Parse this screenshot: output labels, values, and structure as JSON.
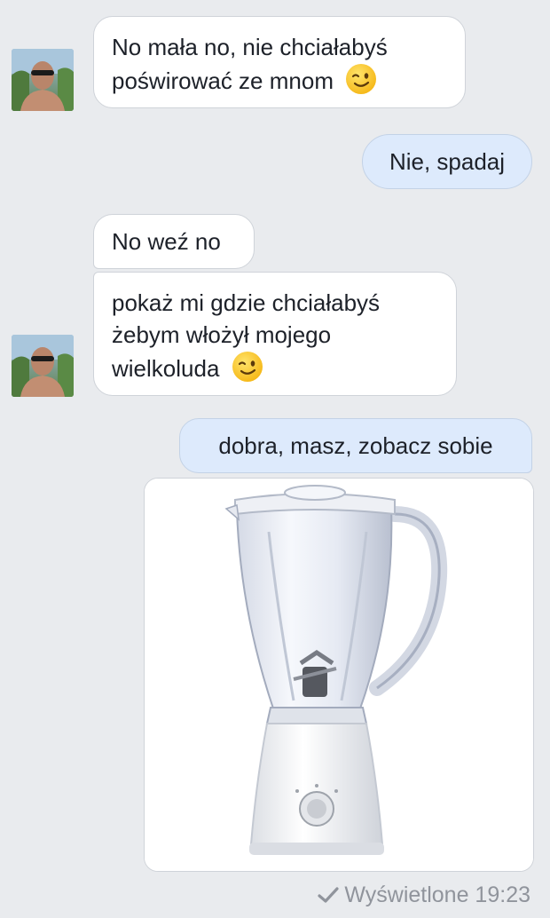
{
  "messages": [
    {
      "direction": "incoming",
      "text": "No mała no, nie chciałabyś poświrować ze mnom",
      "emoji": "winking-face"
    },
    {
      "direction": "outgoing",
      "text": "Nie, spadaj"
    },
    {
      "direction": "incoming",
      "text": "No weź no"
    },
    {
      "direction": "incoming",
      "text": "pokaż mi gdzie chciałabyś żebym włożył mojego wielkoluda",
      "emoji": "winking-face"
    },
    {
      "direction": "outgoing",
      "text": "dobra, masz, zobacz sobie"
    },
    {
      "direction": "outgoing",
      "attachment": "blender-photo"
    }
  ],
  "status": {
    "icon": "checkmark-icon",
    "text": "Wyświetlone 19:23"
  },
  "colors": {
    "background": "#e9ebee",
    "incoming_bubble": "#ffffff",
    "outgoing_bubble": "#ddeafc",
    "status_text": "#90949c"
  }
}
